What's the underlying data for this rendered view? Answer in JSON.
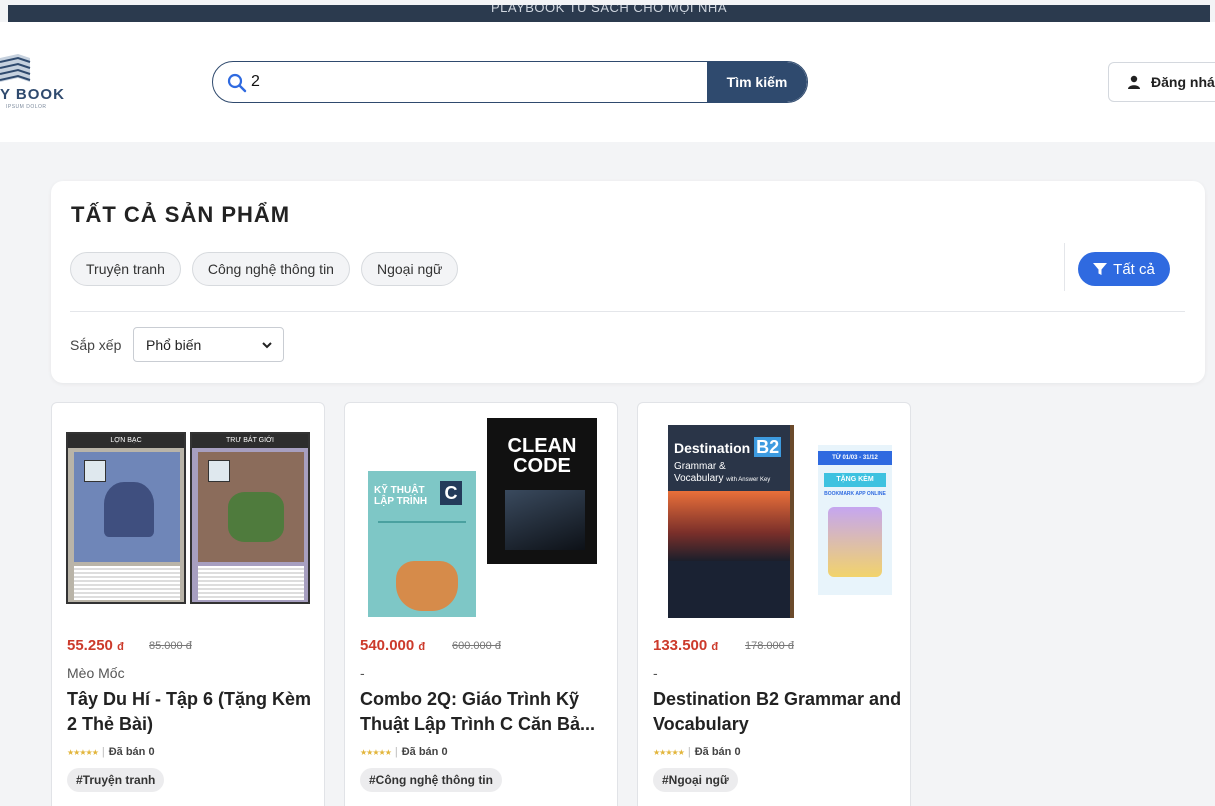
{
  "banner": {
    "text": "PLAYBOOK TỦ SÁCH CHO MỌI NHÀ"
  },
  "header": {
    "logo_text": "Y BOOK",
    "logo_sub": "IPSUM DOLOR",
    "search": {
      "value": "2",
      "button_label": "Tìm kiếm"
    },
    "login_label": "Đăng nhá"
  },
  "catalog": {
    "title": "TẤT CẢ SẢN PHẨM",
    "categories": [
      "Truyện tranh",
      "Công nghệ thông tin",
      "Ngoại ngữ"
    ],
    "filter_all_label": "Tất cả",
    "sort": {
      "label": "Sắp xếp",
      "selected": "Phổ biến"
    }
  },
  "products": [
    {
      "price": "55.250",
      "currency": "đ",
      "old_price": "85.000 đ",
      "author": "Mèo Mốc",
      "title": "Tây Du Hí - Tập 6 (Tặng Kèm 2 Thẻ Bài)",
      "sold": "Đã bán 0",
      "tag": "#Truyện tranh",
      "cover": {
        "card_left": "LỢN BẠC",
        "card_right": "TRƯ BÁT GIỚI"
      }
    },
    {
      "price": "540.000",
      "currency": "đ",
      "old_price": "600.000 đ",
      "author": "-",
      "title": "Combo 2Q: Giáo Trình Kỹ Thuật Lập Trình C Căn Bả...",
      "sold": "Đã bán 0",
      "tag": "#Công nghệ thông tin",
      "cover": {
        "book_left_line1": "KỸ THUẬT",
        "book_left_line2": "LẬP TRÌNH",
        "book_left_letter": "C",
        "book_right_line1": "CLEAN",
        "book_right_line2": "CODE"
      }
    },
    {
      "price": "133.500",
      "currency": "đ",
      "old_price": "178.000 đ",
      "author": "-",
      "title": "Destination B2 Grammar and Vocabulary",
      "sold": "Đã bán 0",
      "tag": "#Ngoại ngữ",
      "cover": {
        "book_title": "Destination",
        "book_level": "B2",
        "book_sub1": "Grammar &",
        "book_sub2": "Vocabulary",
        "book_sub3": "with Answer Key",
        "promo_date": "TỪ 01/03 - 31/12",
        "promo_gift": "TẶNG KÈM",
        "promo_item": "BOOKMARK APP ONLINE"
      }
    }
  ],
  "colors": {
    "brand": "#2f4a6e",
    "accent_blue": "#2f6ae0",
    "price_red": "#cc3a2b"
  }
}
